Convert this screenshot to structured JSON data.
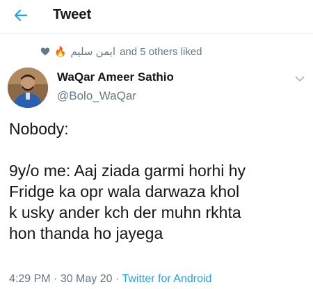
{
  "header": {
    "title": "Tweet",
    "back_icon": "arrow-left-icon",
    "accent": "#1da1f2"
  },
  "social_context": {
    "liker_name": "ایمن سلیم",
    "liker_emoji": "🔥",
    "suffix": "and 5 others liked",
    "icon": "heart-icon"
  },
  "author": {
    "name": "WaQar Ameer Sathio",
    "handle": "@Bolo_WaQar",
    "avatar_icon": "avatar",
    "menu_icon": "chevron-down-icon"
  },
  "tweet": {
    "lines": [
      "Nobody:",
      "",
      "9y/o me: Aaj ziada garmi horhi hy",
      "Fridge ka opr wala darwaza khol",
      "k usky ander kch der muhn rkhta",
      "hon thanda ho jayega"
    ]
  },
  "meta": {
    "time": "4:29 PM",
    "separator": " · ",
    "date": "30 May 20",
    "source": "Twitter for Android"
  },
  "colors": {
    "text_primary": "#14171a",
    "text_secondary": "#657786",
    "link": "#1da1f2"
  }
}
